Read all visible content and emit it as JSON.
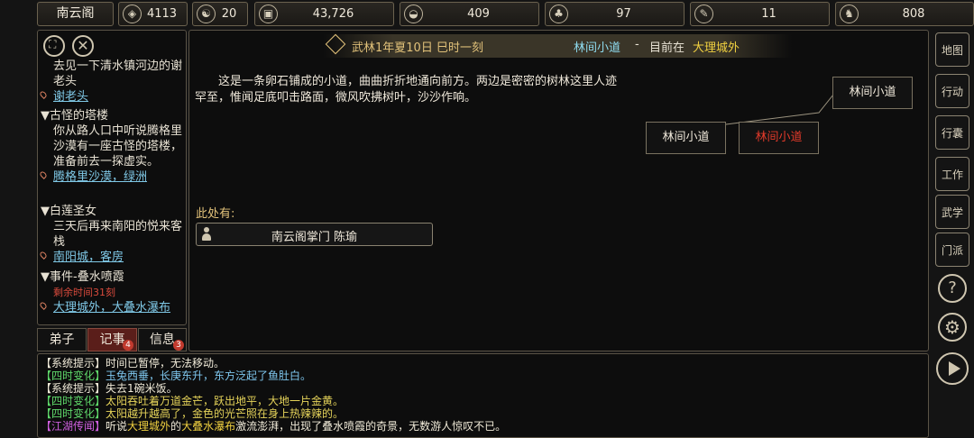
{
  "top_bar": {
    "sect_name": "南云阁",
    "stats": [
      {
        "icon": "coin-bag-icon",
        "value": "4113"
      },
      {
        "icon": "yin-yang-icon",
        "value": "20"
      },
      {
        "icon": "copper-coin-icon",
        "value": "43,726"
      },
      {
        "icon": "rice-bowl-icon",
        "value": "409"
      },
      {
        "icon": "herb-icon",
        "value": "97"
      },
      {
        "icon": "scroll-icon",
        "value": "11"
      },
      {
        "icon": "horse-icon",
        "value": "808"
      }
    ]
  },
  "quest_panel": {
    "sections": [
      {
        "text": "去见一下清水镇河边的谢老头",
        "location": "谢老头"
      },
      {
        "title": "▼古怪的塔楼",
        "text": "你从路人口中听说腾格里沙漠有一座古怪的塔楼，准备前去一探虚实。",
        "location": "腾格里沙漠，绿洲"
      },
      {
        "title": "▼白莲圣女",
        "text": "三天后再来南阳的悦来客栈",
        "location": "南阳城，客房"
      },
      {
        "title": "▼事件-叠水喷霞",
        "note": "剩余时间31刻",
        "location": "大理城外，大叠水瀑布"
      }
    ],
    "tabs": [
      {
        "label": "弟子",
        "badge": ""
      },
      {
        "label": "记事",
        "badge": "4"
      },
      {
        "label": "信息",
        "badge": "3"
      }
    ]
  },
  "header": {
    "date": "武林1年夏10日 巳时一刻",
    "place": "林间小道",
    "separator": "-",
    "current_prefix": "目前在",
    "current_area": "大理城外"
  },
  "description": "这是一条卵石铺成的小道，曲曲折折地通向前方。两边是密密的树林这里人迹罕至，惟闻足底叩击路面，微风吹拂树叶，沙沙作响。",
  "minimap": {
    "nodes": [
      "林间小道",
      "林间小道",
      "林间小道"
    ]
  },
  "here": {
    "label": "此处有:",
    "npc": "南云阁掌门 陈瑜"
  },
  "side_menu": [
    "地图",
    "行动",
    "行囊",
    "工作",
    "武学",
    "门派"
  ],
  "log": [
    {
      "tag": "【系统提示】",
      "text": "时间已暂停，无法移动。",
      "tag_color": "#f0ead8",
      "text_color": "#f0ead8"
    },
    {
      "tag": "【四时变化】",
      "text": "玉兔西垂，长庚东升，东方泛起了鱼肚白。",
      "tag_color": "#5fd86a",
      "text_color": "#7fc8f0"
    },
    {
      "tag": "【系统提示】",
      "text": "失去1碗米饭。",
      "tag_color": "#f0ead8",
      "text_color": "#f0ead8"
    },
    {
      "tag": "【四时变化】",
      "text": "太阳吞吐着万道金芒，跃出地平，大地一片金黄。",
      "tag_color": "#5fd86a",
      "text_color": "#e6d45a"
    },
    {
      "tag": "【四时变化】",
      "text": "太阳越升越高了，金色的光芒照在身上热辣辣的。",
      "tag_color": "#5fd86a",
      "text_color": "#e6d45a"
    },
    {
      "tag": "【江湖传闻】",
      "text_before": "听说",
      "highlight1": "大理城外",
      "text_mid": "的",
      "highlight2": "大叠水瀑布",
      "text_after": "激流澎湃，出现了叠水喷霞的奇景，无数游人惊叹不已。",
      "tag_color": "#d060e0"
    }
  ],
  "colors": {
    "accent_gold": "#e2c27a",
    "place_cyan": "#8fdcf0",
    "current_red": "#e23a2a",
    "highlight_yellow": "#f0d040"
  }
}
